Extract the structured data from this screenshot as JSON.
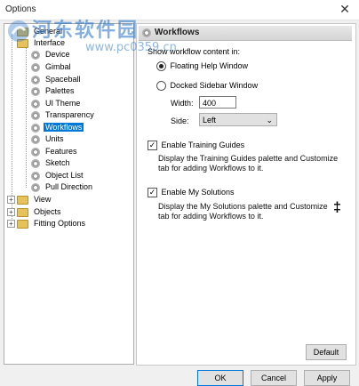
{
  "window": {
    "title": "Options",
    "close_glyph": "✕"
  },
  "watermark": {
    "text_cn": "河东软件园",
    "url": "www.pc0359.cn",
    "logo_icon": "watermark-logo-icon"
  },
  "tree": {
    "items": [
      {
        "label": "General",
        "type": "folder"
      },
      {
        "label": "Interface",
        "type": "folder"
      },
      {
        "label": "Device",
        "type": "gear"
      },
      {
        "label": "Gimbal",
        "type": "gear"
      },
      {
        "label": "Spaceball",
        "type": "gear"
      },
      {
        "label": "Palettes",
        "type": "gear"
      },
      {
        "label": "UI Theme",
        "type": "gear"
      },
      {
        "label": "Transparency",
        "type": "gear"
      },
      {
        "label": "Workflows",
        "type": "gear",
        "selected": true
      },
      {
        "label": "Units",
        "type": "gear"
      },
      {
        "label": "Features",
        "type": "gear"
      },
      {
        "label": "Sketch",
        "type": "gear"
      },
      {
        "label": "Object List",
        "type": "gear"
      },
      {
        "label": "Pull Direction",
        "type": "gear"
      },
      {
        "label": "View",
        "type": "folder",
        "expander": "+"
      },
      {
        "label": "Objects",
        "type": "folder",
        "expander": "+"
      },
      {
        "label": "Fitting Options",
        "type": "folder",
        "expander": "+"
      }
    ]
  },
  "panel": {
    "title": "Workflows",
    "show_label": "Show workflow content in:",
    "radio_floating": "Floating Help Window",
    "radio_docked": "Docked Sidebar Window",
    "width_label": "Width:",
    "width_value": "400",
    "side_label": "Side:",
    "side_value": "Left",
    "training_label": "Enable Training Guides",
    "training_desc": "Display the Training Guides palette and Customize tab for adding Workflows to it.",
    "solutions_label": "Enable My Solutions",
    "solutions_desc": "Display the My Solutions palette and Customize tab for adding Workflows to it.",
    "default_btn": "Default"
  },
  "footer": {
    "ok": "OK",
    "cancel": "Cancel",
    "apply": "Apply"
  },
  "colors": {
    "selection": "#0078d7",
    "accent": "#0078d7"
  }
}
